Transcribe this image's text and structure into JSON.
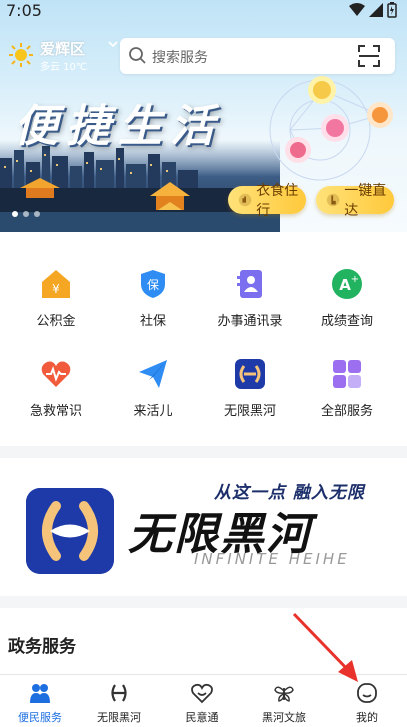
{
  "status_bar": {
    "time": "7:05"
  },
  "header": {
    "location": "爱辉区",
    "weather": "多云 10℃",
    "search_placeholder": "搜索服务"
  },
  "banner": {
    "slogan": "便捷生活",
    "pills": [
      "衣食住行",
      "一键直达"
    ]
  },
  "services": [
    {
      "label": "公积金",
      "icon": "housing-fund-icon",
      "color": "#f5a623"
    },
    {
      "label": "社保",
      "icon": "social-security-icon",
      "color": "#2f8cf2"
    },
    {
      "label": "办事通讯录",
      "icon": "contacts-icon",
      "color": "#7b6ff0"
    },
    {
      "label": "成绩查询",
      "icon": "grade-query-icon",
      "color": "#21b35f"
    },
    {
      "label": "急救常识",
      "icon": "first-aid-icon",
      "color": "#f25a3c"
    },
    {
      "label": "来活儿",
      "icon": "paper-plane-icon",
      "color": "#2f8cf2"
    },
    {
      "label": "无限黑河",
      "icon": "wuxian-heihe-icon",
      "color": "#1e3aa8"
    },
    {
      "label": "全部服务",
      "icon": "all-services-icon",
      "color": "#9b6ff0"
    }
  ],
  "promo": {
    "tagline": "从这一点  融入无限",
    "title": "无限黑河",
    "english": "INFINITE HEIHE"
  },
  "gov_section": {
    "title": "政务服务"
  },
  "tabbar": [
    {
      "label": "便民服务",
      "icon": "people-icon",
      "active": true
    },
    {
      "label": "无限黑河",
      "icon": "infinity-logo-icon",
      "active": false
    },
    {
      "label": "民意通",
      "icon": "heart-icon",
      "active": false
    },
    {
      "label": "黑河文旅",
      "icon": "butterfly-icon",
      "active": false
    },
    {
      "label": "我的",
      "icon": "smiley-face-icon",
      "active": false
    }
  ],
  "colors": {
    "accent": "#1d6fe0",
    "arrow": "#e8322b",
    "pill": "#ffc93b"
  }
}
